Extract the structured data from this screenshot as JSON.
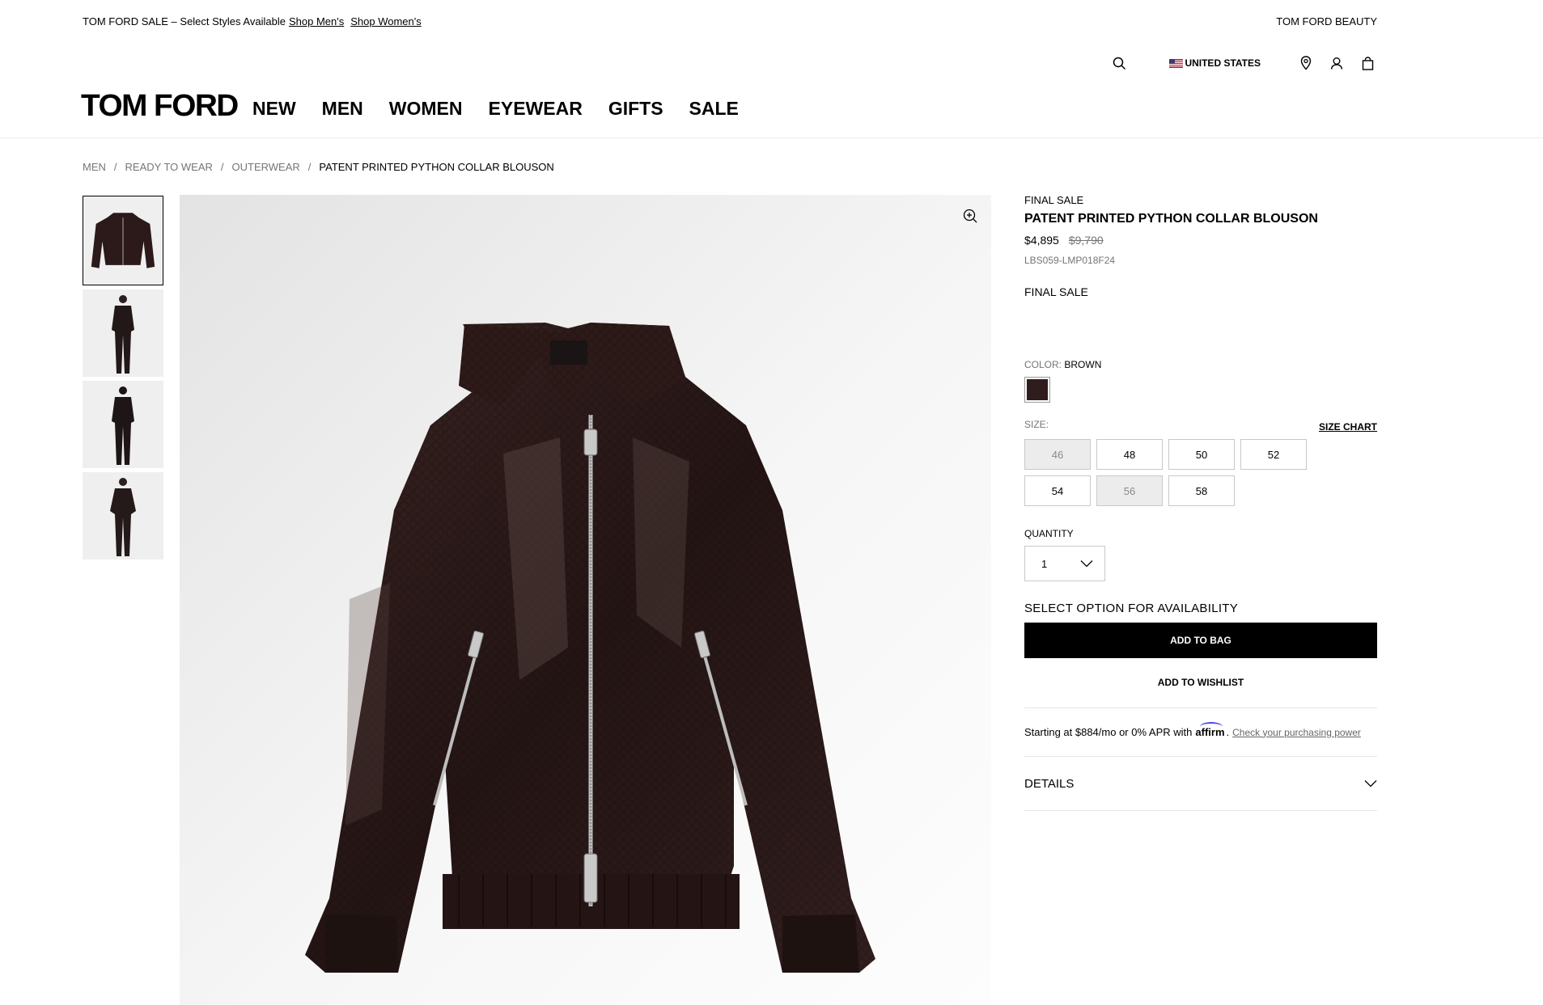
{
  "promo": {
    "message": "TOM FORD SALE – Select Styles Available",
    "shop_mens": "Shop Men's",
    "shop_womens": "Shop Women's",
    "beauty_link": "TOM FORD BEAUTY"
  },
  "utility": {
    "country": "UNITED STATES",
    "icons": [
      "search-icon",
      "us-flag-icon",
      "location-pin-icon",
      "account-icon",
      "shopping-bag-icon"
    ]
  },
  "header": {
    "logo": "TOM FORD",
    "nav": [
      "NEW",
      "MEN",
      "WOMEN",
      "EYEWEAR",
      "GIFTS",
      "SALE"
    ]
  },
  "breadcrumb": {
    "items": [
      "MEN",
      "READY TO WEAR",
      "OUTERWEAR"
    ],
    "separator": "/",
    "current": "PATENT PRINTED PYTHON COLLAR BLOUSON"
  },
  "gallery": {
    "thumbnails": [
      "jacket-front",
      "model-front",
      "model-back",
      "model-front-open"
    ],
    "selected_index": 0,
    "zoom_icon": "zoom-in-icon"
  },
  "product": {
    "tag": "FINAL SALE",
    "name": "PATENT PRINTED PYTHON COLLAR BLOUSON",
    "price": "$4,895",
    "original_price": "$9,790",
    "sku": "LBS059-LMP018F24",
    "final_sale_note": "FINAL SALE",
    "color_label": "COLOR:",
    "color_value": "BROWN",
    "swatch_color": "#2e1d1c",
    "size_label": "SIZE:",
    "size_chart": "SIZE CHART",
    "sizes": [
      {
        "label": "46",
        "available": false
      },
      {
        "label": "48",
        "available": true
      },
      {
        "label": "50",
        "available": true
      },
      {
        "label": "52",
        "available": true
      },
      {
        "label": "54",
        "available": true
      },
      {
        "label": "56",
        "available": false
      },
      {
        "label": "58",
        "available": true
      }
    ],
    "quantity_label": "QUANTITY",
    "quantity_value": "1",
    "availability": "SELECT OPTION FOR AVAILABILITY",
    "add_to_bag": "ADD TO BAG",
    "add_to_wishlist": "ADD TO WISHLIST",
    "affirm_text": "Starting at $884/mo or 0% APR with",
    "affirm_brand": "affirm",
    "affirm_link": "Check your purchasing power",
    "details": "DETAILS"
  }
}
